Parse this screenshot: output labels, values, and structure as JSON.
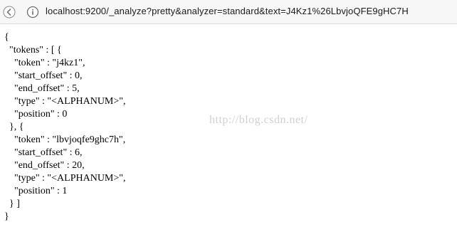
{
  "browser": {
    "url": "localhost:9200/_analyze?pretty&analyzer=standard&text=J4Kz1%26LbvjoQFE9gHC7H",
    "back_icon": "back-arrow-icon",
    "info_icon": "info-circle-icon"
  },
  "json_lines": [
    "{",
    "  \"tokens\" : [ {",
    "    \"token\" : \"j4kz1\",",
    "    \"start_offset\" : 0,",
    "    \"end_offset\" : 5,",
    "    \"type\" : \"<ALPHANUM>\",",
    "    \"position\" : 0",
    "  }, {",
    "    \"token\" : \"lbvjoqfe9ghc7h\",",
    "    \"start_offset\" : 6,",
    "    \"end_offset\" : 20,",
    "    \"type\" : \"<ALPHANUM>\",",
    "    \"position\" : 1",
    "  } ]",
    "}"
  ],
  "watermark": "http://blog.csdn.net/"
}
